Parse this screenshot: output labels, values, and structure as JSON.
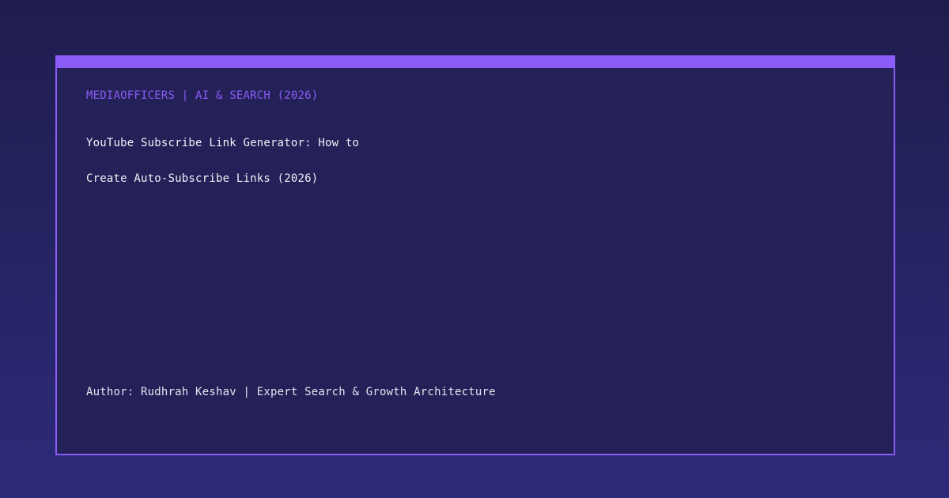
{
  "card": {
    "brand": "MEDIAOFFICERS | AI & SEARCH (2026)",
    "title_lines": [
      "YouTube Subscribe Link Generator: How to",
      "Create Auto-Subscribe Links (2026)"
    ],
    "author": "Author: Rudhrah Keshav | Expert Search & Growth Architecture"
  },
  "colors": {
    "accent": "#8b5cf6",
    "card_background": "#232158",
    "page_background_top": "#1f1c4d",
    "page_background_bottom": "#2e2a7a",
    "text": "#f1f1f7"
  }
}
